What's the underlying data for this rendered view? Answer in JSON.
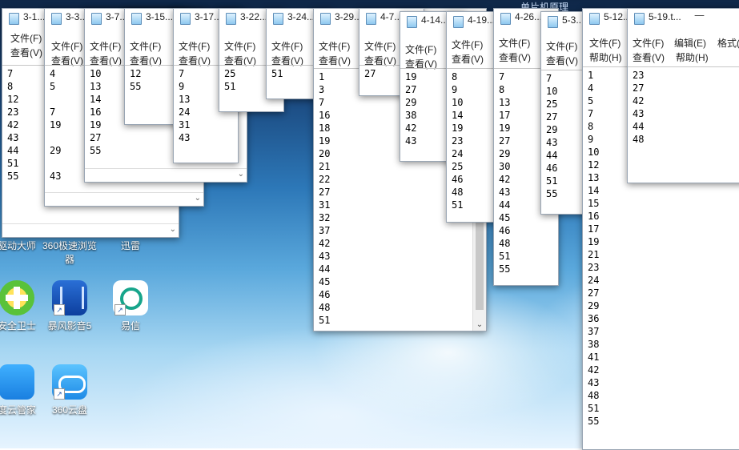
{
  "desktop": {
    "icons": [
      {
        "label": "驱动大师",
        "icon": "driver-master-icon"
      },
      {
        "label": "360极速浏览器",
        "icon": "360-browser-icon"
      },
      {
        "label": "迅雷",
        "icon": "xunlei-icon"
      },
      {
        "label": "安全卫士",
        "icon": "360-security-icon"
      },
      {
        "label": "暴风影音5",
        "icon": "baofeng-video-icon"
      },
      {
        "label": "易信",
        "icon": "yixin-icon"
      },
      {
        "label": "度云管家",
        "icon": "baidu-cloud-icon"
      },
      {
        "label": "360云盘",
        "icon": "360-cloud-icon"
      }
    ],
    "background_text": "单片机原理"
  },
  "windows": [
    {
      "title": "3-1...",
      "menu": [
        "文件(F)",
        "查看(V)"
      ],
      "content": [
        "7",
        "8",
        "12",
        "23",
        "42",
        "43",
        "44",
        "51",
        "55"
      ]
    },
    {
      "title": "3-3...",
      "menu": [
        "文件(F)",
        "查看(V)"
      ],
      "content": [
        "4",
        "5",
        "",
        "7",
        "19",
        "",
        "29",
        "",
        "43"
      ]
    },
    {
      "title": "3-7...",
      "menu": [
        "文件(F)",
        "查看(V)"
      ],
      "content": [
        "10",
        "13",
        "14",
        "16",
        "19",
        "27",
        "55"
      ]
    },
    {
      "title": "3-15...",
      "menu": [
        "文件(F)",
        "查看(V)"
      ],
      "content": [
        "12",
        "55"
      ]
    },
    {
      "title": "3-17...",
      "menu": [
        "文件(F)",
        "查看(V)"
      ],
      "content": [
        "7",
        "9",
        "13",
        "24",
        "31",
        "43"
      ]
    },
    {
      "title": "3-22...",
      "menu": [
        "文件(F)",
        "查看(V)"
      ],
      "content": [
        "25",
        "51"
      ]
    },
    {
      "title": "3-24...",
      "menu": [
        "文件(F)",
        "查看(V)"
      ],
      "content": [
        "51"
      ]
    },
    {
      "title": "3-29...",
      "menu": [
        "文件(F)",
        "查看(V)"
      ],
      "content": [
        "1",
        "3",
        "7",
        "16",
        "18",
        "19",
        "20",
        "21",
        "22",
        "27",
        "31",
        "32",
        "37",
        "42",
        "43",
        "44",
        "45",
        "46",
        "48",
        "51"
      ]
    },
    {
      "title": "4-7...",
      "menu": [
        "文件(F)",
        "查看(V)"
      ],
      "content": [
        "27"
      ]
    },
    {
      "title": "4-14...",
      "menu": [
        "文件(F)",
        "查看(V)"
      ],
      "content": [
        "19",
        "27",
        "29",
        "38",
        "42",
        "43"
      ]
    },
    {
      "title": "4-19...",
      "menu": [
        "文件(F)",
        "查看(V)"
      ],
      "content": [
        "8",
        "9",
        "10",
        "14",
        "19",
        "23",
        "24",
        "25",
        "46",
        "48",
        "51"
      ]
    },
    {
      "title": "4-26...",
      "menu": [
        "文件(F)",
        "查看(V)"
      ],
      "content": [
        "7",
        "8",
        "13",
        "17",
        "19",
        "27",
        "29",
        "30",
        "42",
        "43",
        "44",
        "45",
        "46",
        "48",
        "51",
        "55"
      ]
    },
    {
      "title": "5-3...",
      "menu": [
        "文件(F)",
        "查看(V)"
      ],
      "content": [
        "7",
        "10",
        "25",
        "27",
        "29",
        "43",
        "44",
        "46",
        "51",
        "55"
      ]
    },
    {
      "title": "5-12...",
      "menu": [
        "文件(F)",
        "帮助(H)"
      ],
      "content": [
        "1",
        "4",
        "5",
        "7",
        "8",
        "9",
        "10",
        "12",
        "13",
        "14",
        "15",
        "16",
        "17",
        "19",
        "21",
        "23",
        "24",
        "27",
        "29",
        "36",
        "37",
        "38",
        "41",
        "42",
        "43",
        "48",
        "51",
        "55"
      ]
    },
    {
      "title": "5-19.t...",
      "menu": [
        "文件(F)",
        "编辑(E)",
        "格式(",
        "查看(V)",
        "帮助(H)"
      ],
      "content": [
        "23",
        "27",
        "42",
        "43",
        "44",
        "48"
      ]
    }
  ]
}
